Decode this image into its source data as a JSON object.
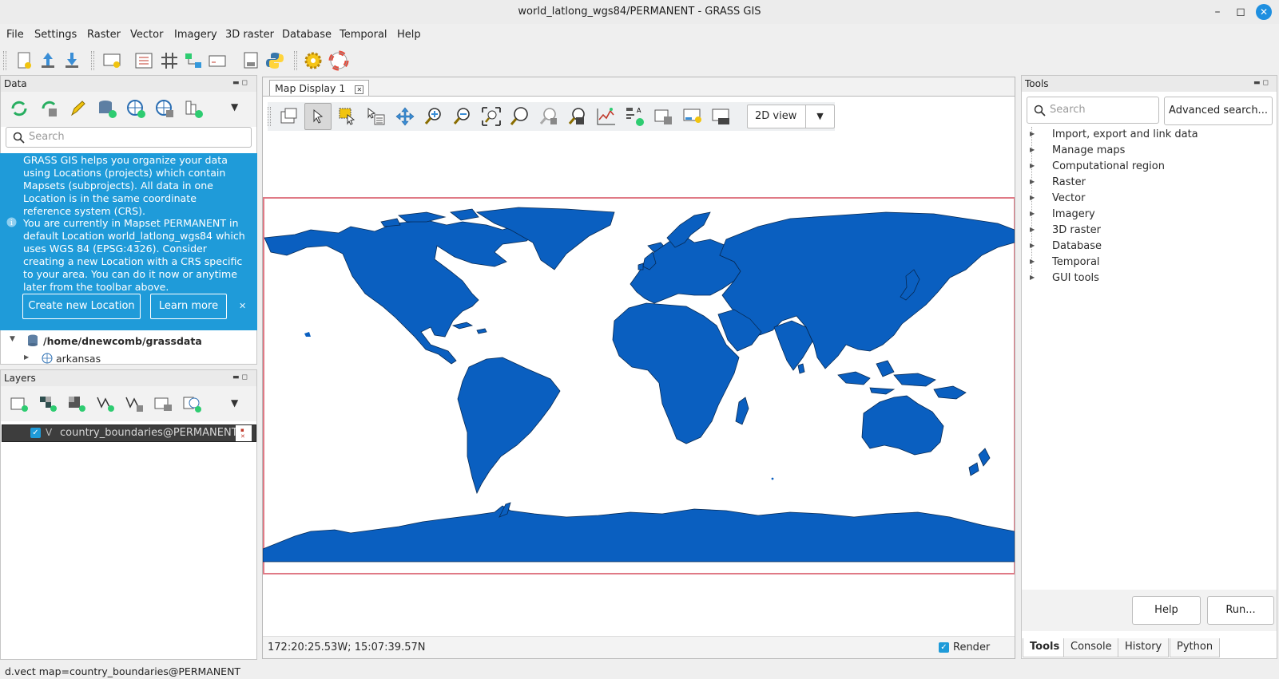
{
  "window": {
    "title": "world_latlong_wgs84/PERMANENT - GRASS GIS",
    "minimize": "–",
    "maximize": "◻",
    "close": "✕"
  },
  "menu": [
    "File",
    "Settings",
    "Raster",
    "Vector",
    "Imagery",
    "3D raster",
    "Database",
    "Temporal",
    "Help"
  ],
  "data_panel": {
    "title": "Data",
    "search_placeholder": "Search",
    "info_1": "GRASS GIS helps you organize your data using Locations (projects) which contain Mapsets (subprojects). All data in one Location is in the same coordinate reference system (CRS).",
    "info_2": "You are currently in Mapset PERMANENT in default Location world_latlong_wgs84 which uses WGS 84 (EPSG:4326). Consider creating a new Location with a CRS specific to your area. You can do it now or anytime later from the toolbar above.",
    "create_button": "Create new Location",
    "learn_button": "Learn more",
    "tree_root": "/home/dnewcomb/grassdata",
    "tree_child": "arkansas"
  },
  "layers_panel": {
    "title": "Layers",
    "layer_name": "country_boundaries@PERMANENT",
    "layer_type": "V"
  },
  "map_display": {
    "tab_label": "Map Display 1",
    "view_mode": "2D view",
    "coords": "172:20:25.53W; 15:07:39.57N",
    "render_label": "Render"
  },
  "tools_panel": {
    "title": "Tools",
    "search_placeholder": "Search",
    "advanced_button": "Advanced search...",
    "items": [
      "Import, export and link data",
      "Manage maps",
      "Computational region",
      "Raster",
      "Vector",
      "Imagery",
      "3D raster",
      "Database",
      "Temporal",
      "GUI tools"
    ],
    "help_button": "Help",
    "run_button": "Run...",
    "tabs": [
      "Tools",
      "Console",
      "History",
      "Python"
    ]
  },
  "status_command": "d.vect map=country_boundaries@PERMANENT",
  "colors": {
    "accent": "#1f9bd9",
    "land": "#0a5fc0",
    "region_border": "#e07a86"
  }
}
